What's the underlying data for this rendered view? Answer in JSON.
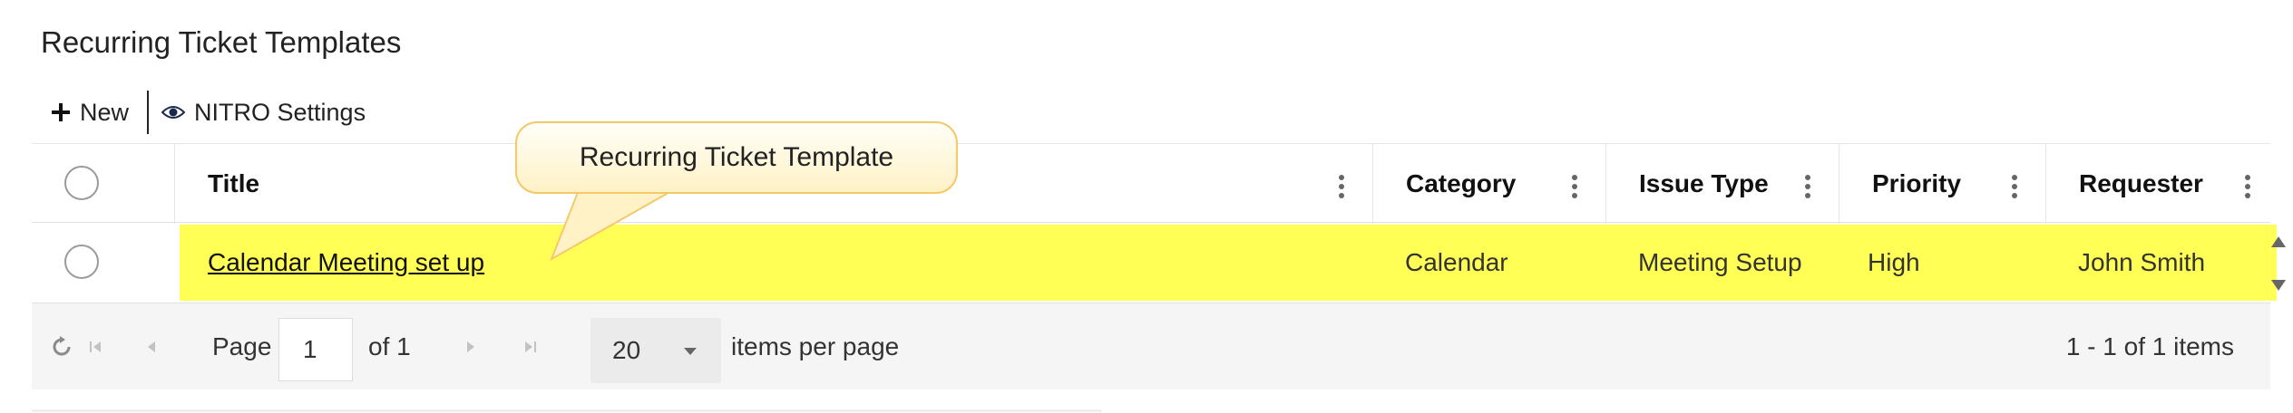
{
  "page": {
    "title": "Recurring Ticket Templates"
  },
  "toolbar": {
    "new_label": "New",
    "new_icon": "plus-icon",
    "settings_label": "NITRO Settings",
    "settings_icon": "eye-icon"
  },
  "columns": [
    {
      "label": "Title"
    },
    {
      "label": "Category"
    },
    {
      "label": "Issue Type"
    },
    {
      "label": "Priority"
    },
    {
      "label": "Requester"
    }
  ],
  "rows": [
    {
      "title": "Calendar Meeting set up",
      "category": "Calendar",
      "issue_type": "Meeting Setup",
      "priority": "High",
      "requester": "John Smith",
      "highlight_color": "#ffff55"
    }
  ],
  "pager": {
    "page_label": "Page",
    "page_value": "1",
    "of_label": "of 1",
    "page_size": "20",
    "items_per_page_label": "items per page",
    "summary": "1 - 1 of 1 items"
  },
  "callout": {
    "text": "Recurring Ticket Template",
    "border_color": "#f4c96a"
  }
}
